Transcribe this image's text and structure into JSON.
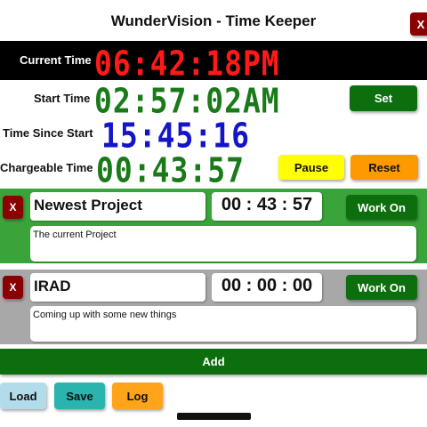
{
  "app": {
    "title": "WunderVision - Time Keeper",
    "close_label": "X"
  },
  "clock": {
    "current_label": "Current Time",
    "current_value": "06:42:18PM",
    "start_label": "Start Time",
    "start_value": "02:57:02AM",
    "since_label": "Time Since Start",
    "since_value": "15:45:16",
    "chargeable_label": "Chargeable Time",
    "chargeable_value": "00:43:57"
  },
  "controls": {
    "set_label": "Set",
    "pause_label": "Pause",
    "reset_label": "Reset"
  },
  "projects": [
    {
      "remove_label": "X",
      "name": "Newest Project",
      "timer": "00 : 43 : 57",
      "work_label": "Work On",
      "description": "The current Project",
      "color": "#3aa43a"
    },
    {
      "remove_label": "X",
      "name": "IRAD",
      "timer": "00 : 00 : 00",
      "work_label": "Work On",
      "description": "Coming up with some new things",
      "color": "#a8a8a8"
    }
  ],
  "footer": {
    "add_label": "Add",
    "load_label": "Load",
    "save_label": "Save",
    "log_label": "Log"
  },
  "colors": {
    "current_time": "#ff1a1a",
    "start_time": "#1a7a1a",
    "since_time": "#1414c8",
    "chargeable_time": "#1a7a1a",
    "accent_green": "#0d6e0d"
  }
}
